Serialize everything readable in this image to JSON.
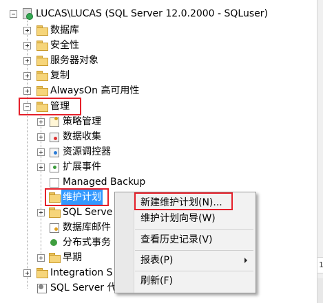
{
  "tree": {
    "root": "LUCAS\\LUCAS (SQL Server 12.0.2000 - SQLuser)",
    "nodes": {
      "databases": "数据库",
      "security": "安全性",
      "server_objects": "服务器对象",
      "replication": "复制",
      "alwayson": "AlwaysOn 高可用性",
      "management": "管理",
      "policy_management": "策略管理",
      "data_collection": "数据收集",
      "resource_governor": "资源调控器",
      "extended_events": "扩展事件",
      "managed_backup": "Managed Backup",
      "maintenance_plans": "维护计划",
      "sql_server_logs": "SQL Serve",
      "database_mail": "数据库邮件",
      "dtc": "分布式事务",
      "legacy": "早期",
      "integration_services": "Integration S",
      "sql_agent": "SQL Server 代"
    }
  },
  "context_menu": {
    "new_maintenance_plan": "新建维护计划(N)...",
    "maintenance_plan_wizard": "维护计划向导(W)",
    "view_history": "查看历史记录(V)",
    "reports": "报表(P)",
    "refresh": "刷新(F)"
  },
  "right_pane": {
    "fragment": "1"
  },
  "colors": {
    "highlight_border": "#e5202a",
    "selection": "#3399ff",
    "menu_bg": "#f2f2f2"
  }
}
